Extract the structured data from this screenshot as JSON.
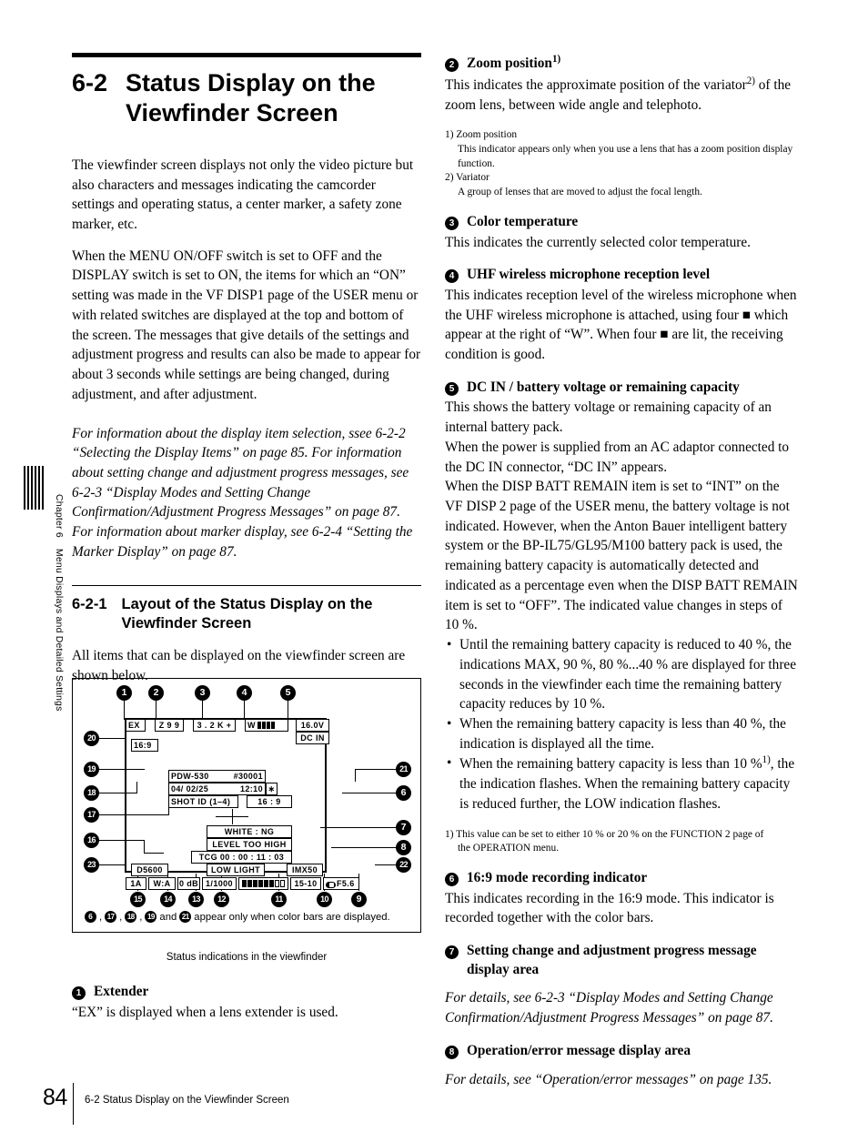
{
  "sidebar": {
    "chapter": "Chapter 6",
    "title": "Menu Displays and Detailed Settings"
  },
  "footer": {
    "page_number": "84",
    "running_head": "6-2 Status Display on the Viewfinder Screen"
  },
  "left_column": {
    "section_number": "6-2",
    "section_title": "Status Display on the Viewfinder Screen",
    "intro_p1": "The viewfinder screen displays not only the video picture but also characters and messages indicating the camcorder settings and operating status, a center marker, a safety zone marker, etc.",
    "intro_p2": "When the MENU ON/OFF switch is set to OFF and the DISPLAY switch is set to ON, the items for which an “ON” setting was made in the VF DISP1 page of the USER menu or with related switches are displayed at the top and bottom of the screen. The messages that give details of the settings and adjustment progress and results can also be made to appear for about 3 seconds while settings are being changed, during adjustment, and after adjustment.",
    "note_italic": "For information about the display item selection, ssee 6-2-2 “Selecting the Display Items” on page 85. For information about setting change and adjustment progress messages, see 6-2-3 “Display Modes and Setting Change Confirmation/Adjustment Progress Messages” on page 87. For information about marker display, see 6-2-4 “Setting the Marker Display” on page 87.",
    "subsection_number": "6-2-1",
    "subsection_title": "Layout of the Status Display on the Viewfinder Screen",
    "subsection_intro": "All items that can be displayed on the viewfinder screen are shown below.",
    "figure_caption": "Status indications in the viewfinder",
    "figure_footnote_numbers": [
      "6",
      "17",
      "18",
      "19",
      "21"
    ],
    "figure_footnote_text": "appear only when color bars are displayed.",
    "item1_number": "1",
    "item1_title": "Extender",
    "item1_body": "“EX” is displayed when a lens extender is used."
  },
  "viewfinder": {
    "extender": "EX",
    "zoom_position": "Z 9 9",
    "color_temperature": "3 . 2 K +",
    "uhf_label": "W",
    "uhf_segments": 4,
    "voltage": "16.0V",
    "dc_in": "DC IN",
    "aspect_16_9": "16:9",
    "model": "PDW-530",
    "serial": "#30001",
    "date": "04/  02/25",
    "time": "12:10",
    "asterisk": "∗",
    "shot_id": "SHOT ID (1–4)",
    "mode_16_9": "16 : 9",
    "message_line1": "WHITE : NG",
    "message_line2": "LEVEL TOO HIGH",
    "timecode": "TCG   00 : 00 : 11 : 03",
    "operation_message": "LOW LIGHT",
    "color_temp_preset": "D5600",
    "format": "IMX50",
    "filter": "1A",
    "white_balance": "W:A",
    "gain": "0 dB",
    "shutter": "1/1000",
    "audio_filled": 6,
    "audio_empty": 2,
    "remaining": "15-10",
    "iris": "F5.6",
    "callouts_top": [
      "1",
      "2",
      "3",
      "4",
      "5"
    ],
    "callouts_left": [
      "20",
      "19",
      "18",
      "17",
      "16",
      "23"
    ],
    "callouts_right": [
      "21",
      "6",
      "7",
      "8",
      "22"
    ],
    "callouts_bottom": [
      "15",
      "14",
      "13",
      "12",
      "11",
      "10",
      "9"
    ]
  },
  "right_column": {
    "items": [
      {
        "number": "2",
        "title": "Zoom position",
        "title_sup": "1)",
        "body": "This indicates the approximate position of the variator  of the zoom lens, between wide angle and telephoto.",
        "body_pre": "This indicates the approximate position of the variator",
        "body_sup": "2)",
        "body_post": " of the zoom lens, between wide angle and telephoto."
      },
      {
        "number": "3",
        "title": "Color temperature",
        "body": "This indicates the currently selected color temperature."
      },
      {
        "number": "4",
        "title": "UHF wireless microphone reception level",
        "body_pre": "This indicates reception level of the wireless microphone when the UHF wireless microphone is attached, using four ",
        "body_mid": " which appear at the right of “W”. When four ",
        "body_post": " are lit, the receiving condition is good."
      },
      {
        "number": "5",
        "title": "DC IN / battery voltage or remaining capacity",
        "paragraphs": [
          "This shows the battery voltage or remaining capacity of an internal battery pack.",
          "When the power is supplied from an AC adaptor connected to the DC IN connector, “DC IN” appears.",
          "When the DISP BATT REMAIN item is set to “INT” on the VF DISP 2 page of the USER menu, the battery voltage is not indicated. However, when the Anton Bauer intelligent battery system or the BP-IL75/GL95/M100 battery pack is used, the remaining battery capacity is automatically detected and indicated as a percentage even when the DISP BATT REMAIN item is set to “OFF”. The indicated value changes in steps of 10 %."
        ],
        "bullets": [
          "Until the remaining battery capacity is reduced to 40 %, the indications MAX, 90 %, 80 %...40 % are displayed for three seconds in the viewfinder each time the remaining battery capacity reduces by 10 %.",
          "When the remaining battery capacity is less than 40 %, the indication is displayed all the time."
        ],
        "bullet3_pre": "When the remaining battery capacity is less than 10 %",
        "bullet3_sup": "1)",
        "bullet3_post": ", the the indication flashes. When the remaining battery capacity is reduced further, the LOW indication flashes."
      },
      {
        "number": "6",
        "title": "16:9 mode recording indicator",
        "body": "This indicates recording in the 16:9 mode. This indicator is recorded together with the color bars."
      },
      {
        "number": "7",
        "title": "Setting change and adjustment progress message display area",
        "note": "For details, see 6-2-3 “Display Modes and Setting Change Confirmation/Adjustment Progress Messages” on page 87."
      },
      {
        "number": "8",
        "title": "Operation/error message display area",
        "note": "For details, see “Operation/error messages” on page 135."
      }
    ],
    "footnotes_zoom": {
      "f1_label": "1) Zoom position",
      "f1_text": "This indicator appears only when you use a lens that has a zoom position display function.",
      "f2_label": "2) Variator",
      "f2_text": "A group of lenses that are moved to adjust the focal length."
    },
    "footnote_battery": {
      "line1": "1) This value can be set to either 10 % or 20 % on the FUNCTION 2 page of",
      "line2": "the OPERATION menu."
    }
  }
}
